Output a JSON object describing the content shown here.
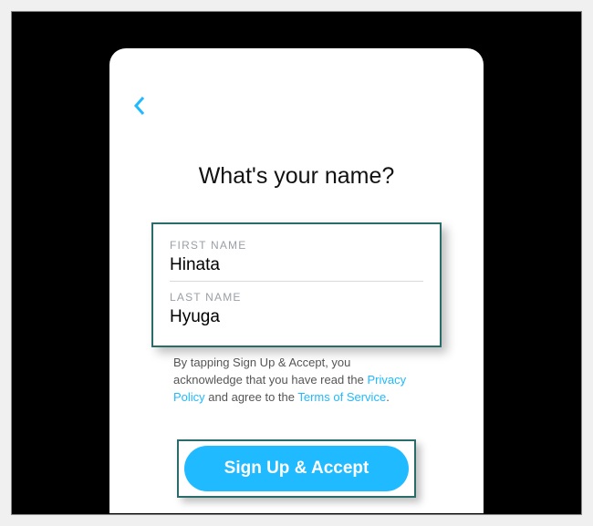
{
  "heading": "What's your name?",
  "form": {
    "first_name_label": "FIRST NAME",
    "first_name_value": "Hinata",
    "last_name_label": "LAST NAME",
    "last_name_value": "Hyuga"
  },
  "disclaimer": {
    "prefix": "By tapping Sign Up & Accept, you acknowledge that you have read the ",
    "privacy": "Privacy Policy",
    "middle": " and agree to the ",
    "terms": "Terms of Service",
    "suffix": "."
  },
  "cta": {
    "label": "Sign Up & Accept"
  }
}
